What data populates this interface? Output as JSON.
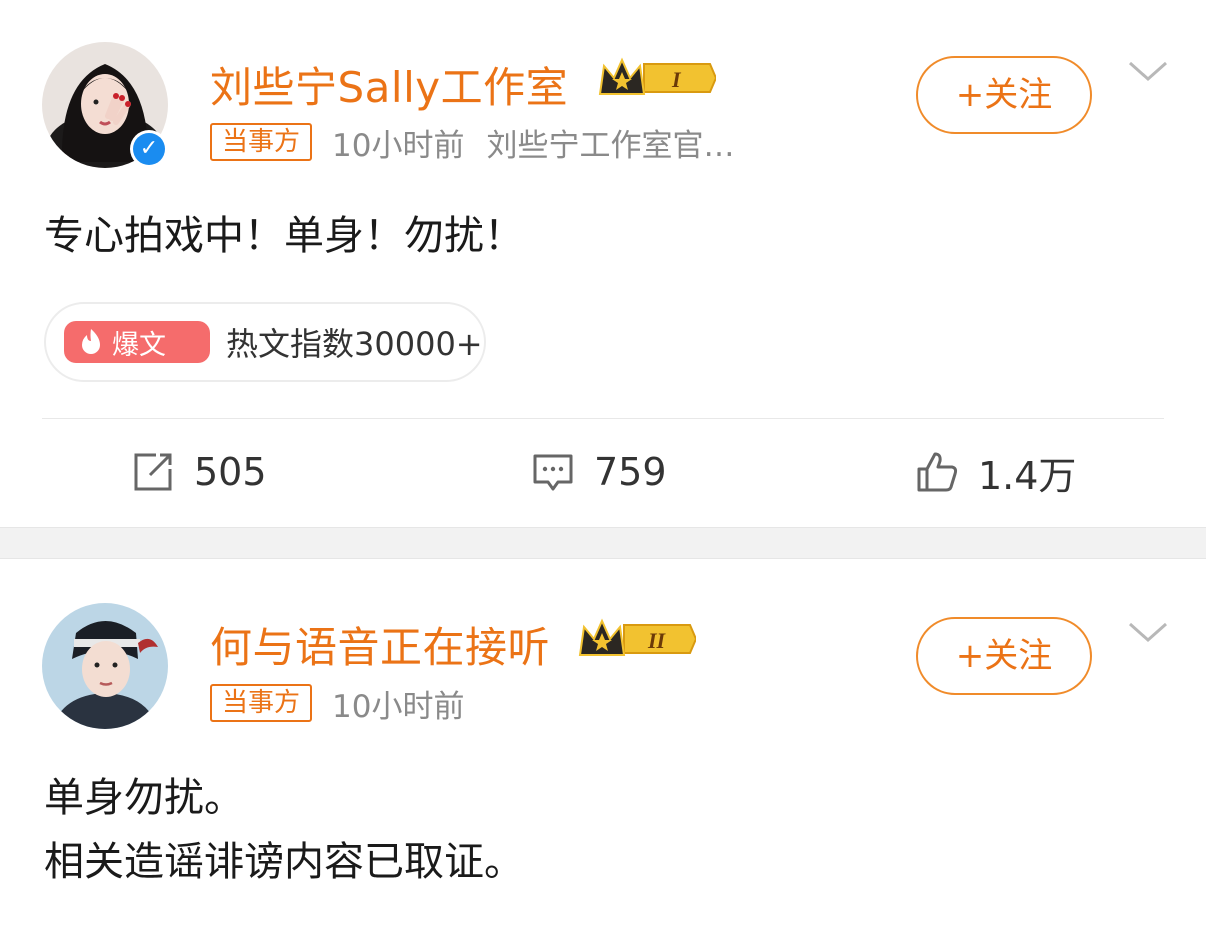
{
  "posts": [
    {
      "author": "刘些宁Sally工作室",
      "verified": true,
      "crown_level": "I",
      "tag": "当事方",
      "time": "10小时前",
      "source": "刘些宁工作室官…",
      "follow_label": "+关注",
      "content_lines": [
        "专心拍戏中！单身！勿扰！"
      ],
      "hot": {
        "badge": "爆文",
        "text": "热文指数30000+"
      },
      "stats": {
        "reposts": "505",
        "comments": "759",
        "likes": "1.4万"
      }
    },
    {
      "author": "何与语音正在接听",
      "verified": false,
      "crown_level": "II",
      "tag": "当事方",
      "time": "10小时前",
      "follow_label": "+关注",
      "content_lines": [
        "单身勿扰。",
        "相关造谣诽谤内容已取证。"
      ]
    }
  ],
  "colors": {
    "accent": "#eb7316",
    "hot_badge": "#f56c6c",
    "verified": "#1a8cf0",
    "crown_gold": "#f2c230"
  },
  "icons": [
    "repost-icon",
    "comment-icon",
    "like-icon",
    "chevron-down-icon",
    "crown-icon",
    "flame-icon",
    "verified-icon"
  ]
}
